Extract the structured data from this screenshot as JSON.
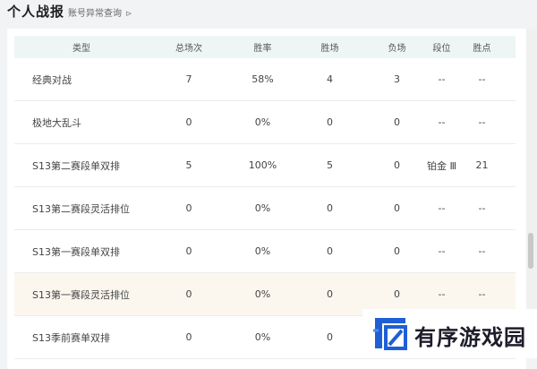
{
  "header": {
    "title": "个人战报",
    "link_label": "账号异常查询",
    "link_arrow": "⊳"
  },
  "table": {
    "columns": [
      "类型",
      "总场次",
      "胜率",
      "胜场",
      "负场",
      "段位",
      "胜点"
    ],
    "rows": [
      {
        "type": "经典对战",
        "total": "7",
        "rate": "58%",
        "wins": "4",
        "losses": "3",
        "rank": "--",
        "lp": "--"
      },
      {
        "type": "极地大乱斗",
        "total": "0",
        "rate": "0%",
        "wins": "0",
        "losses": "0",
        "rank": "--",
        "lp": "--"
      },
      {
        "type": "S13第二赛段单双排",
        "total": "5",
        "rate": "100%",
        "wins": "5",
        "losses": "0",
        "rank": "铂金 Ⅲ",
        "lp": "21"
      },
      {
        "type": "S13第二赛段灵活排位",
        "total": "0",
        "rate": "0%",
        "wins": "0",
        "losses": "0",
        "rank": "--",
        "lp": "--"
      },
      {
        "type": "S13第一赛段单双排",
        "total": "0",
        "rate": "0%",
        "wins": "0",
        "losses": "0",
        "rank": "--",
        "lp": "--"
      },
      {
        "type": "S13第一赛段灵活排位",
        "total": "0",
        "rate": "0%",
        "wins": "0",
        "losses": "0",
        "rank": "--",
        "lp": "--"
      },
      {
        "type": "S13季前赛单双排",
        "total": "0",
        "rate": "0%",
        "wins": "0",
        "losses": "",
        "rank": "",
        "lp": ""
      }
    ]
  },
  "watermark": {
    "text": "有序游戏园",
    "logo_color": "#1f5fd6"
  },
  "colors": {
    "header_row_bg": "#eef6f5",
    "highlight_row_bg": "#fbf7ef",
    "page_bg": "#f2f3f5"
  }
}
